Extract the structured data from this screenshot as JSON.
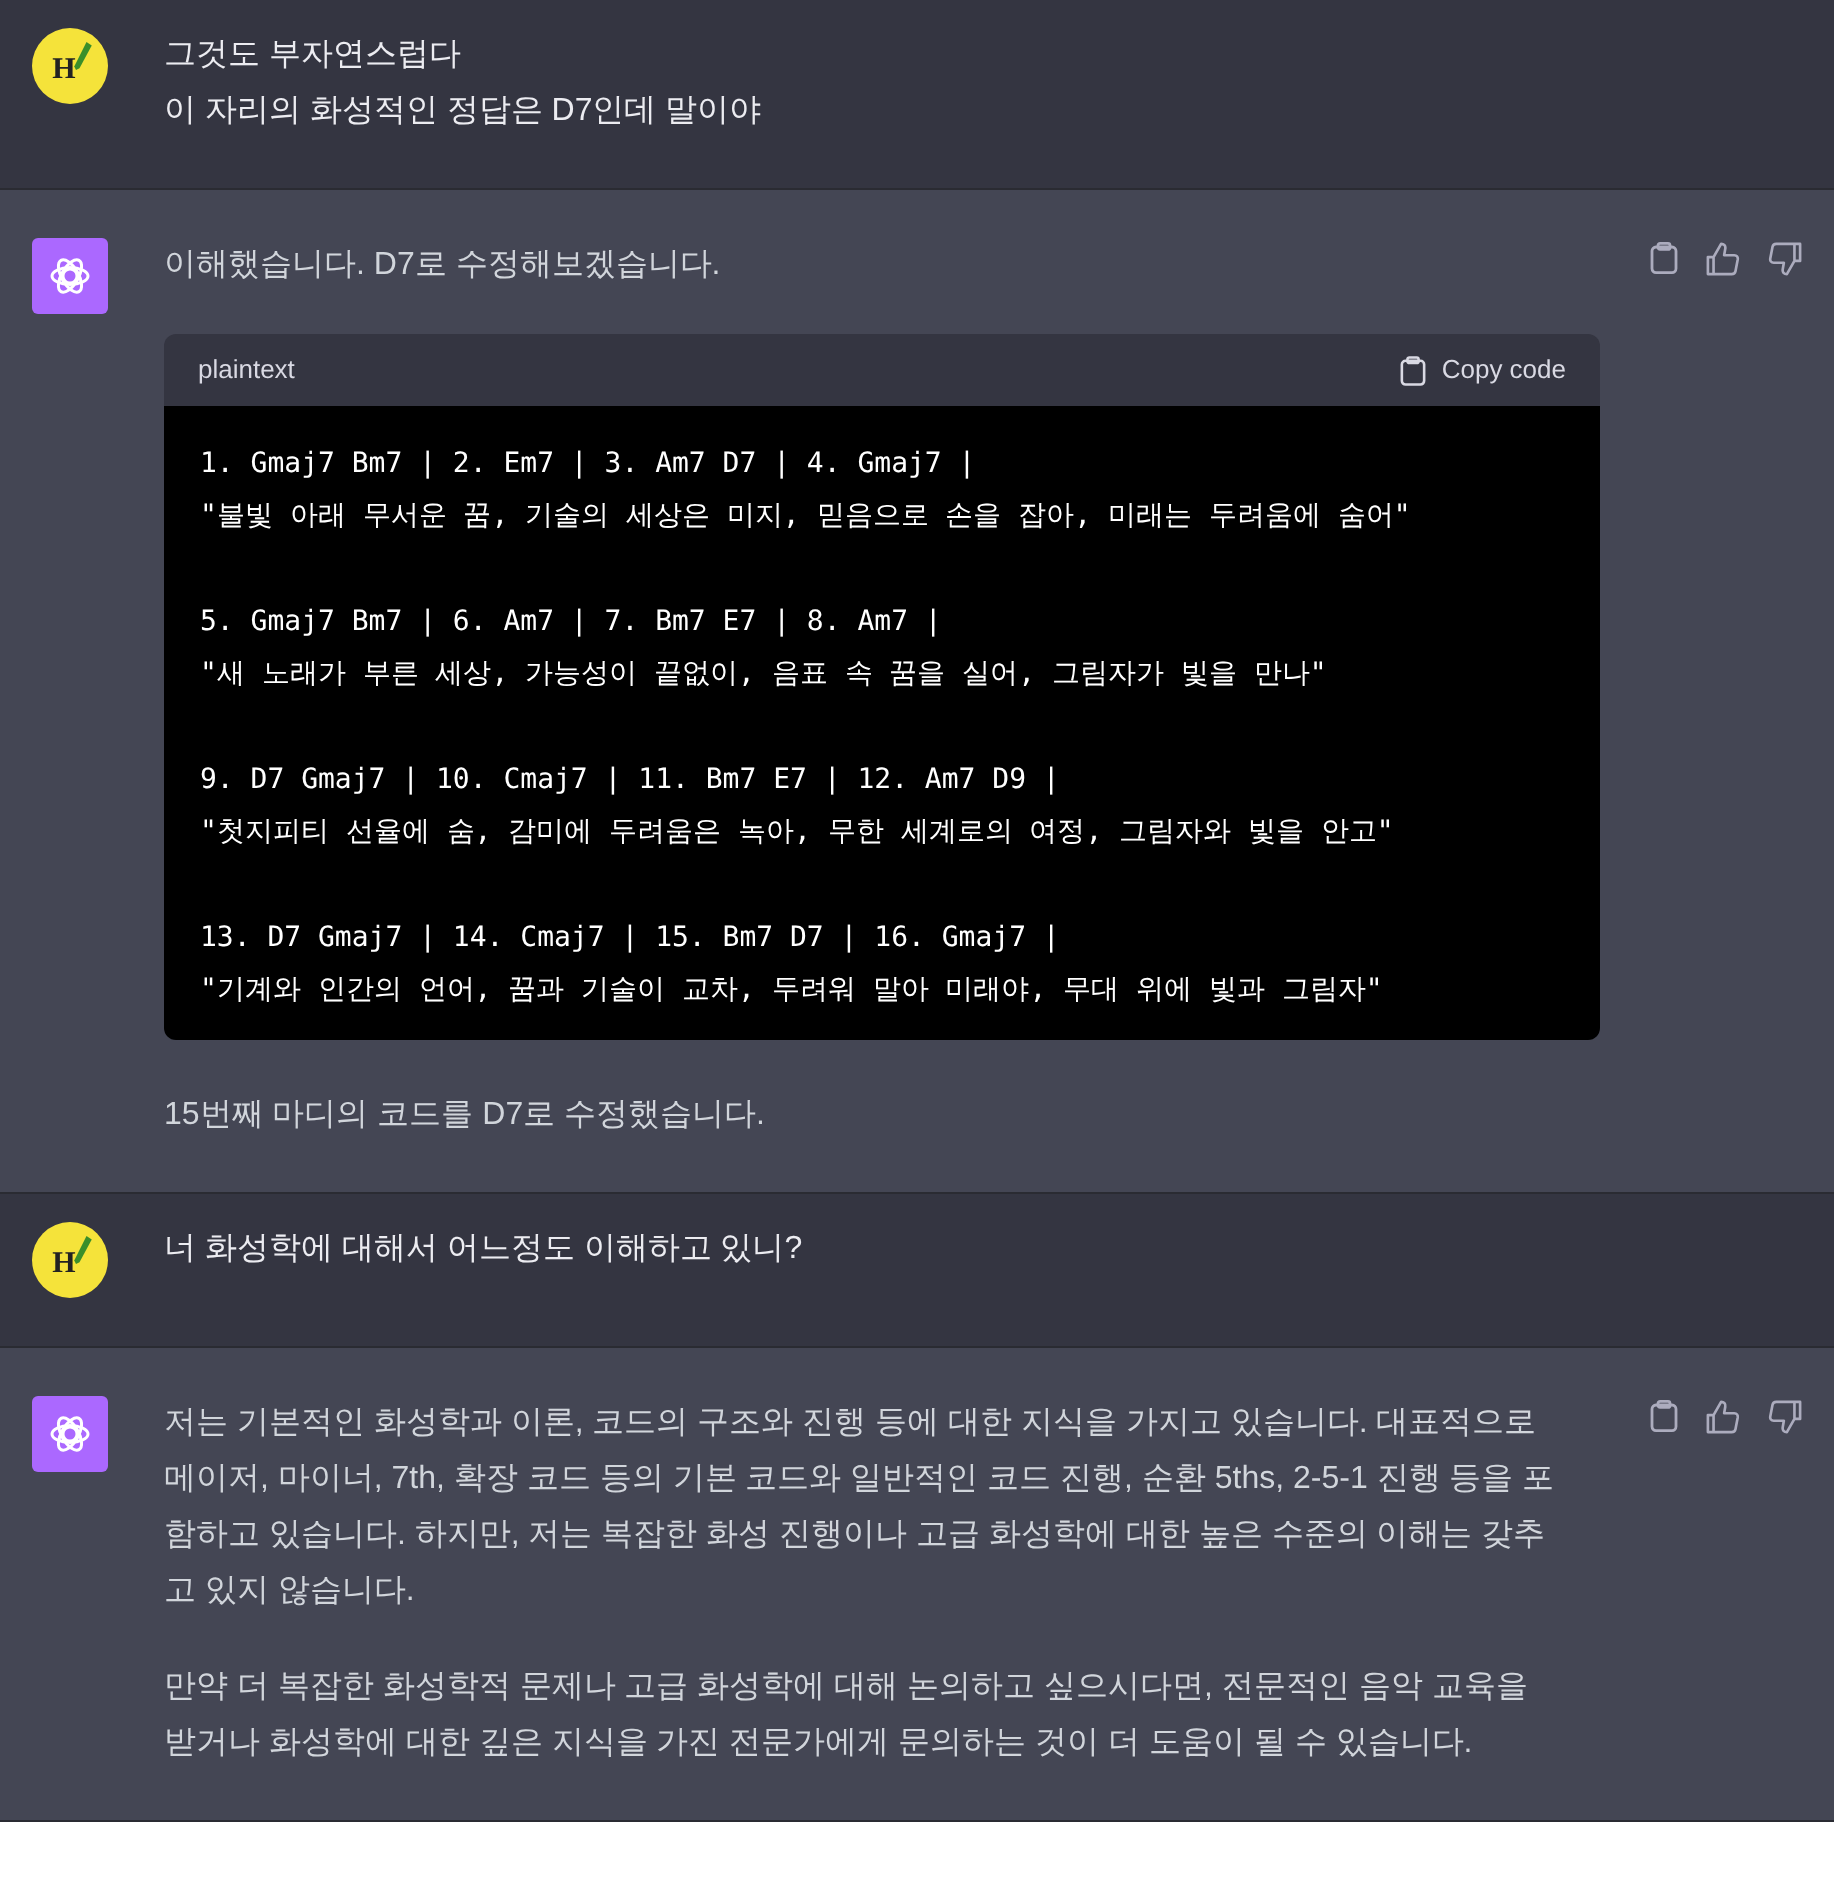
{
  "messages": [
    {
      "kind": "user",
      "avatar_letter": "H",
      "blocks": [
        {
          "kind": "text",
          "lines": [
            "그것도 부자연스럽다",
            "이 자리의 화성적인 정답은 D7인데 말이야"
          ]
        }
      ]
    },
    {
      "kind": "assistant",
      "blocks": [
        {
          "kind": "text",
          "lines": [
            "이해했습니다. D7로 수정해보겠습니다."
          ]
        },
        {
          "kind": "code",
          "language": "plaintext",
          "copy_label": "Copy code",
          "groups": [
            {
              "chords": "1. Gmaj7 Bm7 | 2. Em7 | 3. Am7 D7 | 4. Gmaj7 |",
              "lyric": "\"불빛 아래 무서운 꿈, 기술의 세상은 미지, 믿음으로 손을 잡아, 미래는 두려움에 숨어\""
            },
            {
              "chords": "5. Gmaj7 Bm7 | 6. Am7 | 7. Bm7 E7 | 8. Am7 |",
              "lyric": "\"새 노래가 부른 세상, 가능성이 끝없이, 음표 속 꿈을 실어, 그림자가 빛을 만나\""
            },
            {
              "chords": "9. D7 Gmaj7 | 10. Cmaj7 | 11. Bm7 E7 | 12. Am7 D9 |",
              "lyric": "\"첫지피티 선율에 숨, 감미에 두려움은 녹아, 무한 세계로의 여정, 그림자와 빛을 안고\""
            },
            {
              "chords": "13. D7 Gmaj7 | 14. Cmaj7 | 15. Bm7 D7 | 16. Gmaj7 |",
              "lyric": "\"기계와 인간의 언어, 꿈과 기술이 교차, 두려워 말아 미래야, 무대 위에 빛과 그림자\""
            }
          ]
        },
        {
          "kind": "text",
          "lines": [
            "15번째 마디의 코드를 D7로 수정했습니다."
          ]
        }
      ]
    },
    {
      "kind": "user",
      "avatar_letter": "H",
      "blocks": [
        {
          "kind": "text",
          "lines": [
            "너 화성학에 대해서 어느정도 이해하고 있니?"
          ]
        }
      ]
    },
    {
      "kind": "assistant",
      "blocks": [
        {
          "kind": "text",
          "lines": [
            "저는 기본적인 화성학과 이론, 코드의 구조와 진행 등에 대한 지식을 가지고 있습니다. 대표적으로 메이저, 마이너, 7th, 확장 코드 등의 기본 코드와 일반적인 코드 진행, 순환 5ths, 2-5-1 진행 등을 포함하고 있습니다. 하지만, 저는 복잡한 화성 진행이나 고급 화성학에 대한 높은 수준의 이해는 갖추고 있지 않습니다."
          ]
        },
        {
          "kind": "text",
          "lines": [
            "만약 더 복잡한 화성학적 문제나 고급 화성학에 대해 논의하고 싶으시다면, 전문적인 음악 교육을 받거나 화성학에 대한 깊은 지식을 가진 전문가에게 문의하는 것이 더 도움이 될 수 있습니다."
          ]
        }
      ]
    }
  ]
}
